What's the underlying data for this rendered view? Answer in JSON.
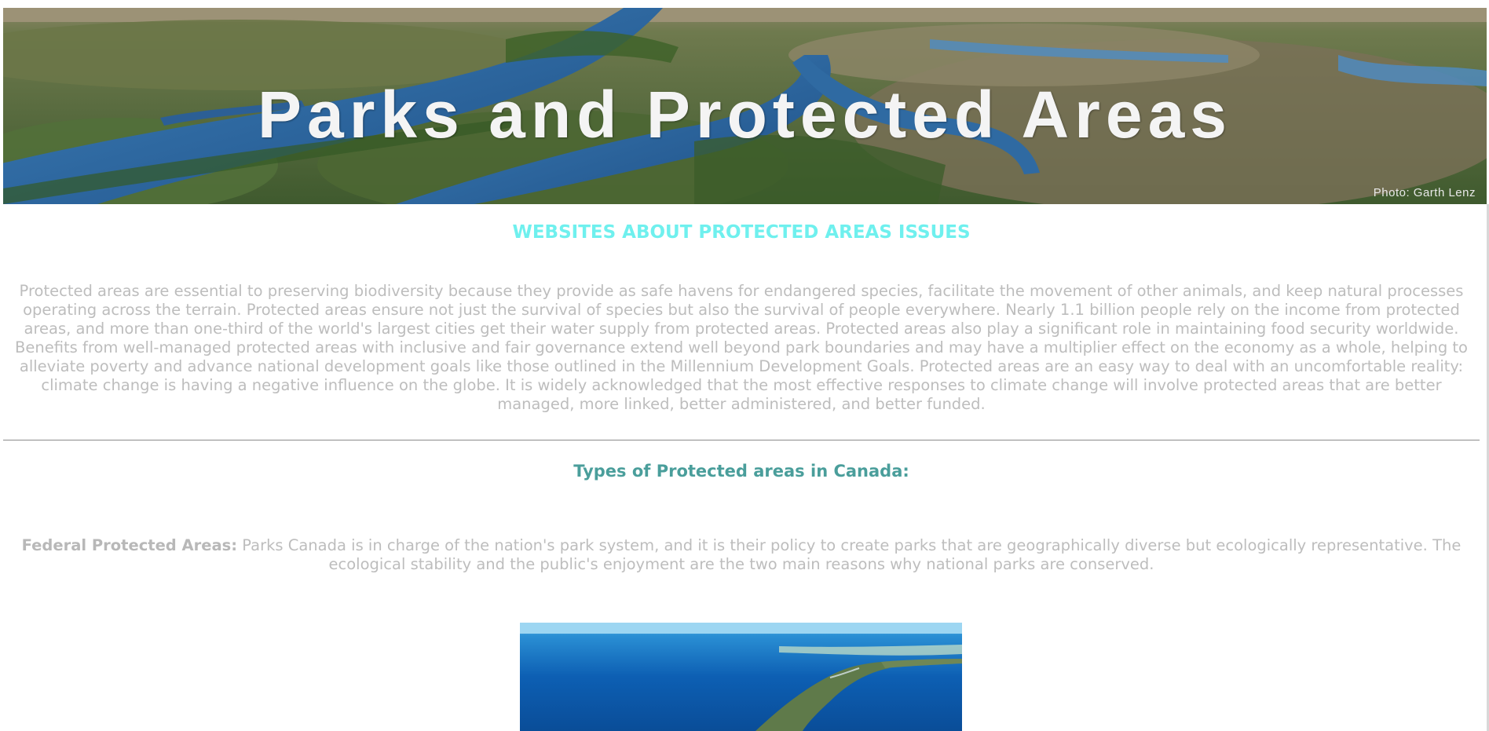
{
  "banner": {
    "title": "Parks and Protected Areas",
    "credit": "Photo: Garth Lenz"
  },
  "main": {
    "heading": "WEBSITES ABOUT PROTECTED AREAS ISSUES",
    "intro": "Protected areas are essential to preserving biodiversity because they provide as safe havens for endangered species, facilitate the movement of other animals, and keep natural processes operating across the terrain. Protected areas ensure not just the survival of species but also the survival of people everywhere. Nearly 1.1 billion people rely on the income from protected areas, and more than one-third of the world's largest cities get their water supply from protected areas. Protected areas also play a significant role in maintaining food security worldwide. Benefits from well-managed protected areas with inclusive and fair governance extend well beyond park boundaries and may have a multiplier effect on the economy as a whole, helping to alleviate poverty and advance national development goals like those outlined in the Millennium Development Goals. Protected areas are an easy way to deal with an uncomfortable reality: climate change is having a negative influence on the globe. It is widely acknowledged that the most effective responses to climate change will involve protected areas that are better managed, more linked, better administered, and better funded.",
    "types_heading": "Types of Protected areas in Canada:",
    "federal": {
      "label": "Federal Protected Areas:",
      "text": " Parks Canada is in charge of the nation's park system, and it is their policy to create parks that are geographically diverse but ecologically representative. The ecological stability and the public's enjoyment are the two main reasons why national parks are conserved."
    }
  },
  "colors": {
    "heading": "#6ff0ee",
    "types_heading": "#4a9e9b",
    "body_text": "#bdbdbd",
    "divider": "#8a8a8a"
  }
}
